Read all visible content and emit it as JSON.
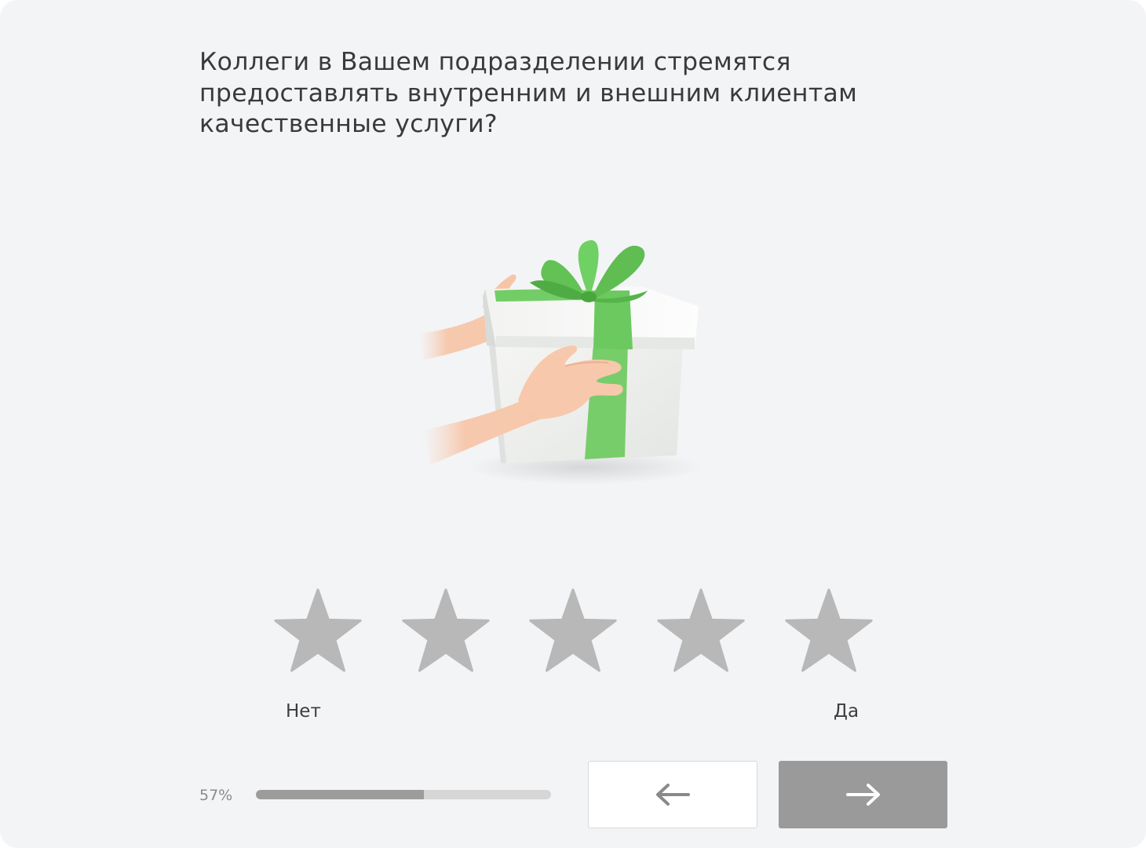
{
  "question": {
    "text": "Коллеги в Вашем подразделении стремятся предоставлять внутренним и внешним клиентам качественные услуги?"
  },
  "illustration": {
    "icon": "gift-box-hands-icon",
    "ribbon_color": "#6cc95f"
  },
  "rating": {
    "max": 5,
    "selected": 0,
    "star_color": "#b8b8b8",
    "low_label": "Нет",
    "high_label": "Да"
  },
  "progress": {
    "percent": 57,
    "label": "57%"
  },
  "navigation": {
    "back_icon": "arrow-left-icon",
    "next_icon": "arrow-right-icon"
  }
}
